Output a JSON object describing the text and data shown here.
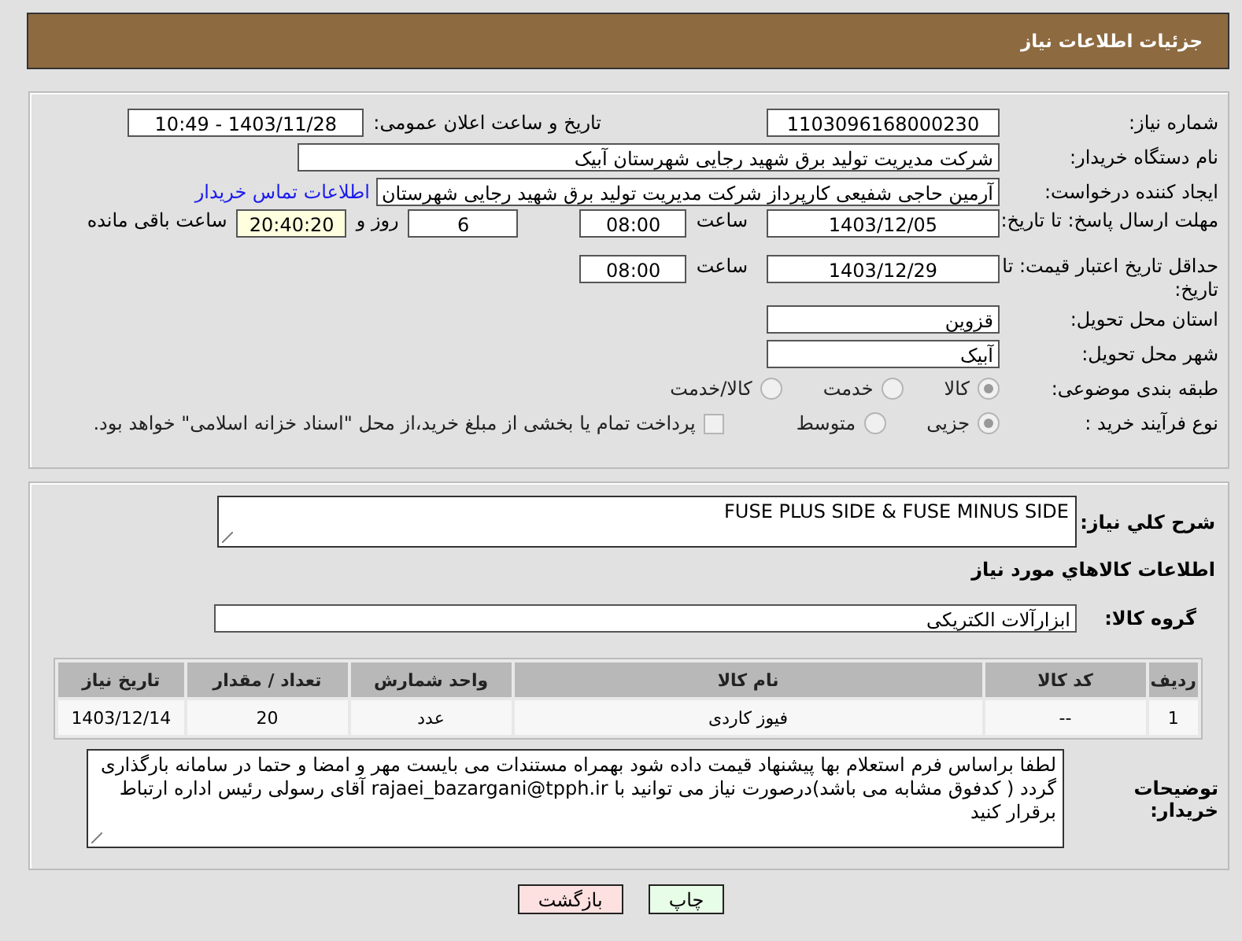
{
  "header": {
    "title": "جزئیات اطلاعات نیاز"
  },
  "need_number": {
    "label": "شماره نیاز:",
    "value": "1103096168000230"
  },
  "announce": {
    "label": "تاریخ و ساعت اعلان عمومی:",
    "value": "1403/11/28 - 10:49"
  },
  "buyer": {
    "label": "نام دستگاه خریدار:",
    "value": "شرکت مدیریت تولید برق شهید رجایی شهرستان آبیک"
  },
  "requester": {
    "label": "ایجاد کننده درخواست:",
    "value": "آرمین حاجی شفیعی کارپرداز شرکت مدیریت تولید برق شهید رجایی شهرستان",
    "link": "اطلاعات تماس خریدار"
  },
  "deadline": {
    "label": "مهلت ارسال پاسخ: تا تاریخ:",
    "date": "1403/12/05",
    "time_label": "ساعت",
    "time": "08:00",
    "days": "6",
    "days_label": "روز و",
    "remaining": "20:40:20",
    "remaining_label": "ساعت باقی مانده"
  },
  "validity": {
    "label": "حداقل تاریخ اعتبار قیمت: تا تاریخ:",
    "date": "1403/12/29",
    "time_label": "ساعت",
    "time": "08:00"
  },
  "province": {
    "label": "استان محل تحویل:",
    "value": "قزوین"
  },
  "city": {
    "label": "شهر محل تحویل:",
    "value": "آبیک"
  },
  "category": {
    "label": "طبقه بندی موضوعی:",
    "options": [
      {
        "label": "کالا",
        "selected": true
      },
      {
        "label": "خدمت",
        "selected": false
      },
      {
        "label": "کالا/خدمت",
        "selected": false
      }
    ]
  },
  "process": {
    "label": "نوع فرآیند خرید :",
    "options": [
      {
        "label": "جزیی",
        "selected": true
      },
      {
        "label": "متوسط",
        "selected": false
      }
    ],
    "checkbox": {
      "label": "پرداخت تمام یا بخشی از مبلغ خرید،از محل \"اسناد خزانه اسلامی\" خواهد بود.",
      "checked": false
    }
  },
  "summary": {
    "label": "شرح کلي نياز:",
    "value": "FUSE PLUS SIDE & FUSE MINUS SIDE"
  },
  "goods_title": "اطلاعات کالاهاي مورد نياز",
  "goods_group": {
    "label": "گروه کالا:",
    "value": "ابزارآلات الکتریکی"
  },
  "table": {
    "columns": [
      "رديف",
      "کد کالا",
      "نام کالا",
      "واحد شمارش",
      "تعداد / مقدار",
      "تاريخ نياز"
    ],
    "rows": [
      [
        "1",
        "--",
        "فیوز کاردی",
        "عدد",
        "20",
        "1403/12/14"
      ]
    ]
  },
  "notes": {
    "label": "توضیحات خریدار:",
    "value": "لطفا براساس فرم استعلام بها پیشنهاد قیمت داده شود بهمراه مستندات می بایست مهر و امضا و حتما در سامانه بارگذاری گردد ( کدفوق مشابه می باشد)درصورت نیاز می توانید با rajaei_bazargani@tpph.ir آقای رسولی رئیس  اداره ارتباط برقرار کنید"
  },
  "buttons": [
    {
      "label": "چاپ",
      "kind": "print"
    },
    {
      "label": "بازگشت",
      "kind": "back"
    }
  ]
}
